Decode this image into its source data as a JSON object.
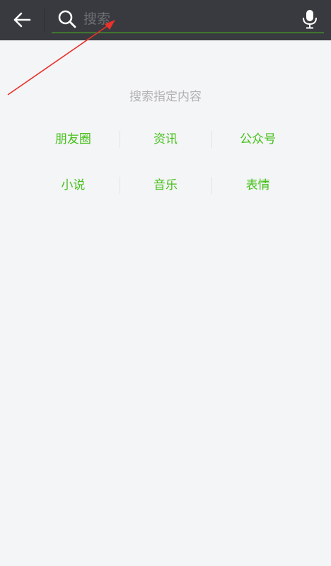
{
  "header": {
    "back_icon": "arrow-left-icon",
    "search_icon": "search-icon",
    "search_placeholder": "搜索",
    "search_value": "",
    "mic_icon": "microphone-icon",
    "accent_color": "#45c01a",
    "bar_color": "#393a3f"
  },
  "main": {
    "title": "搜索指定内容",
    "categories": [
      [
        "朋友圈",
        "资讯",
        "公众号"
      ],
      [
        "小说",
        "音乐",
        "表情"
      ]
    ]
  },
  "annotation": {
    "arrow_color": "#e8322b"
  }
}
